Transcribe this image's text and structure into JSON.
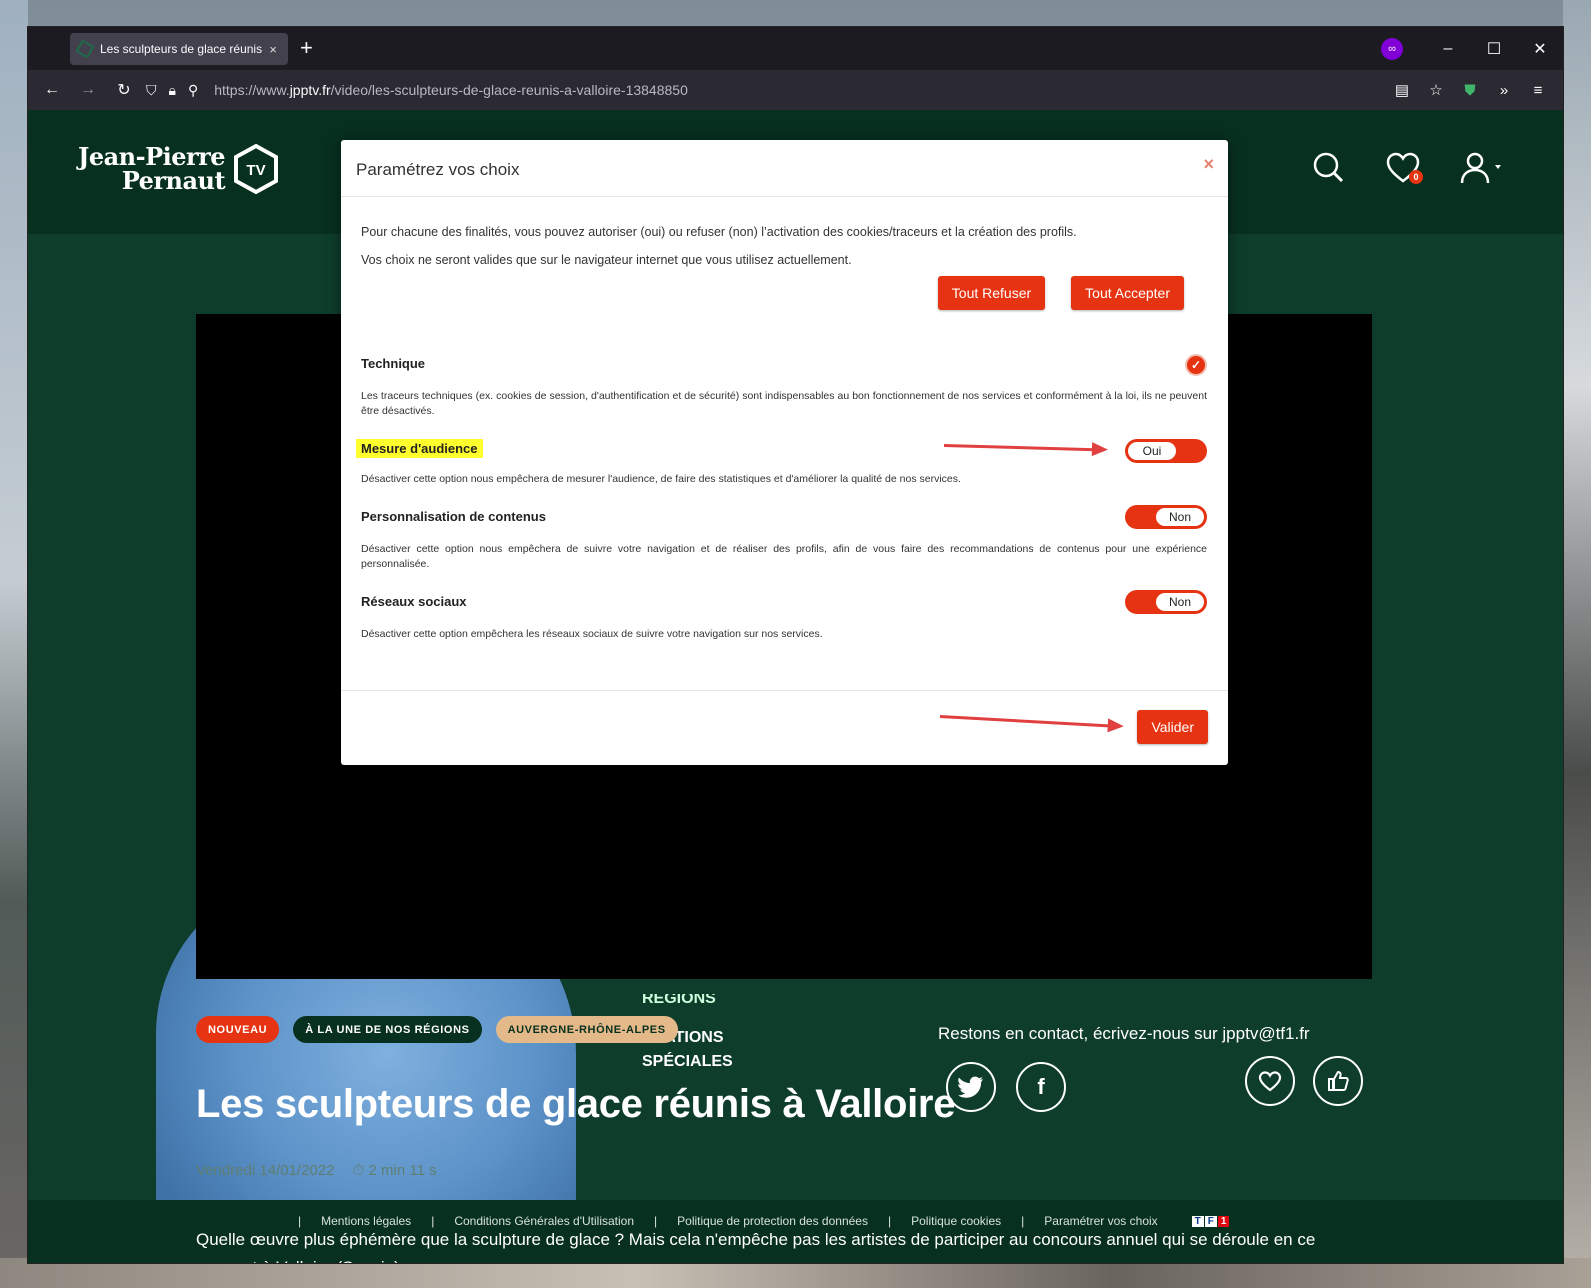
{
  "browser": {
    "tab_title": "Les sculpteurs de glace réunis à",
    "url_prefix": "https://www.",
    "url_domain": "jpptv.fr",
    "url_path": "/video/les-sculpteurs-de-glace-reunis-a-valloire-13848850",
    "new_tab": "+",
    "close_tab": "×"
  },
  "site": {
    "logo_line1": "Jean-Pierre",
    "logo_line2": "Pernaut",
    "logo_badge": "TV",
    "favorites_count": "0"
  },
  "modal": {
    "title": "Paramétrez vos choix",
    "close": "×",
    "intro_1": "Pour chacune des finalités, vous pouvez autoriser (oui) ou refuser (non) l’activation des cookies/traceurs et la création des profils.",
    "intro_2": "Vos choix ne seront valides que sur le navigateur internet que vous utilisez actuellement.",
    "refuse_all": "Tout Refuser",
    "accept_all": "Tout Accepter",
    "sections": [
      {
        "title": "Technique",
        "text": "Les traceurs techniques (ex. cookies de session, d'authentification et de sécurité) sont indispensables au bon fonctionnement de nos services et conformément à la loi, ils ne peuvent être désactivés.",
        "state": "check"
      },
      {
        "title": "Mesure d'audience",
        "text": "Désactiver cette option nous empêchera de mesurer l'audience, de faire des statistiques et d'améliorer la qualité de nos services.",
        "state": "Oui"
      },
      {
        "title": "Personnalisation de contenus",
        "text": "Désactiver cette option nous empêchera de suivre votre navigation et de réaliser des profils, afin de vous faire des recommandations de contenus pour une expérience personnalisée.",
        "state": "Non"
      },
      {
        "title": "Réseaux sociaux",
        "text": "Désactiver cette option empêchera les réseaux sociaux de suivre votre navigation sur nos services.",
        "state": "Non"
      }
    ],
    "validate": "Valider"
  },
  "article": {
    "tags": [
      "NOUVEAU",
      "À LA UNE DE NOS RÉGIONS",
      "AUVERGNE-RHÔNE-ALPES"
    ],
    "menu_cut": "RÉGIONS",
    "menu_1": "ÉRATIONS",
    "menu_2": "SPÉCIALES",
    "contact": "Restons en contact, écrivez-nous sur jpptv@tf1.fr",
    "title": "Les sculpteurs de glace réunis à Valloire",
    "date": "Vendredi 14/01/2022",
    "duration": "⏱ 2 min 11 s",
    "description": "Quelle œuvre plus éphémère que la sculpture de glace ? Mais cela n'empêche pas les artistes de participer au concours annuel qui se déroule en ce moment à Valloire (Savoie)."
  },
  "footer": {
    "links": [
      "Mentions légales",
      "Conditions Générales d'Utilisation",
      "Politique de protection des données",
      "Politique cookies",
      "Paramétrer vos choix"
    ],
    "brand": [
      "T",
      "F",
      "1"
    ]
  }
}
